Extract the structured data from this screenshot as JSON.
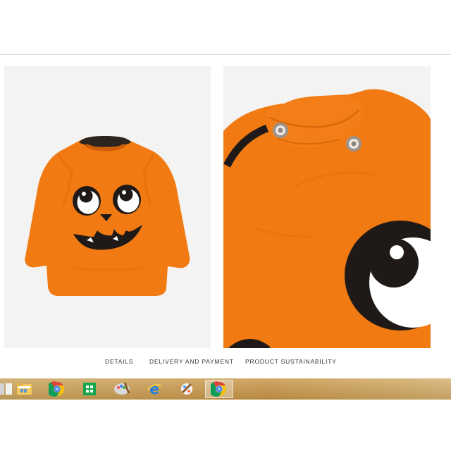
{
  "tabs": {
    "details": "DETAILS",
    "delivery": "DELIVERY AND PAYMENT",
    "sustainability": "PRODUCT SUSTAINABILITY"
  },
  "product": {
    "main_color": "#f27a12",
    "print_color": "#1f1a17"
  },
  "taskbar": {
    "icons": [
      "start-edge-icon",
      "file-explorer-icon",
      "chrome-icon",
      "store-icon",
      "paint-icon",
      "internet-explorer-icon",
      "paint-brush-icon",
      "chrome-active-icon"
    ]
  }
}
